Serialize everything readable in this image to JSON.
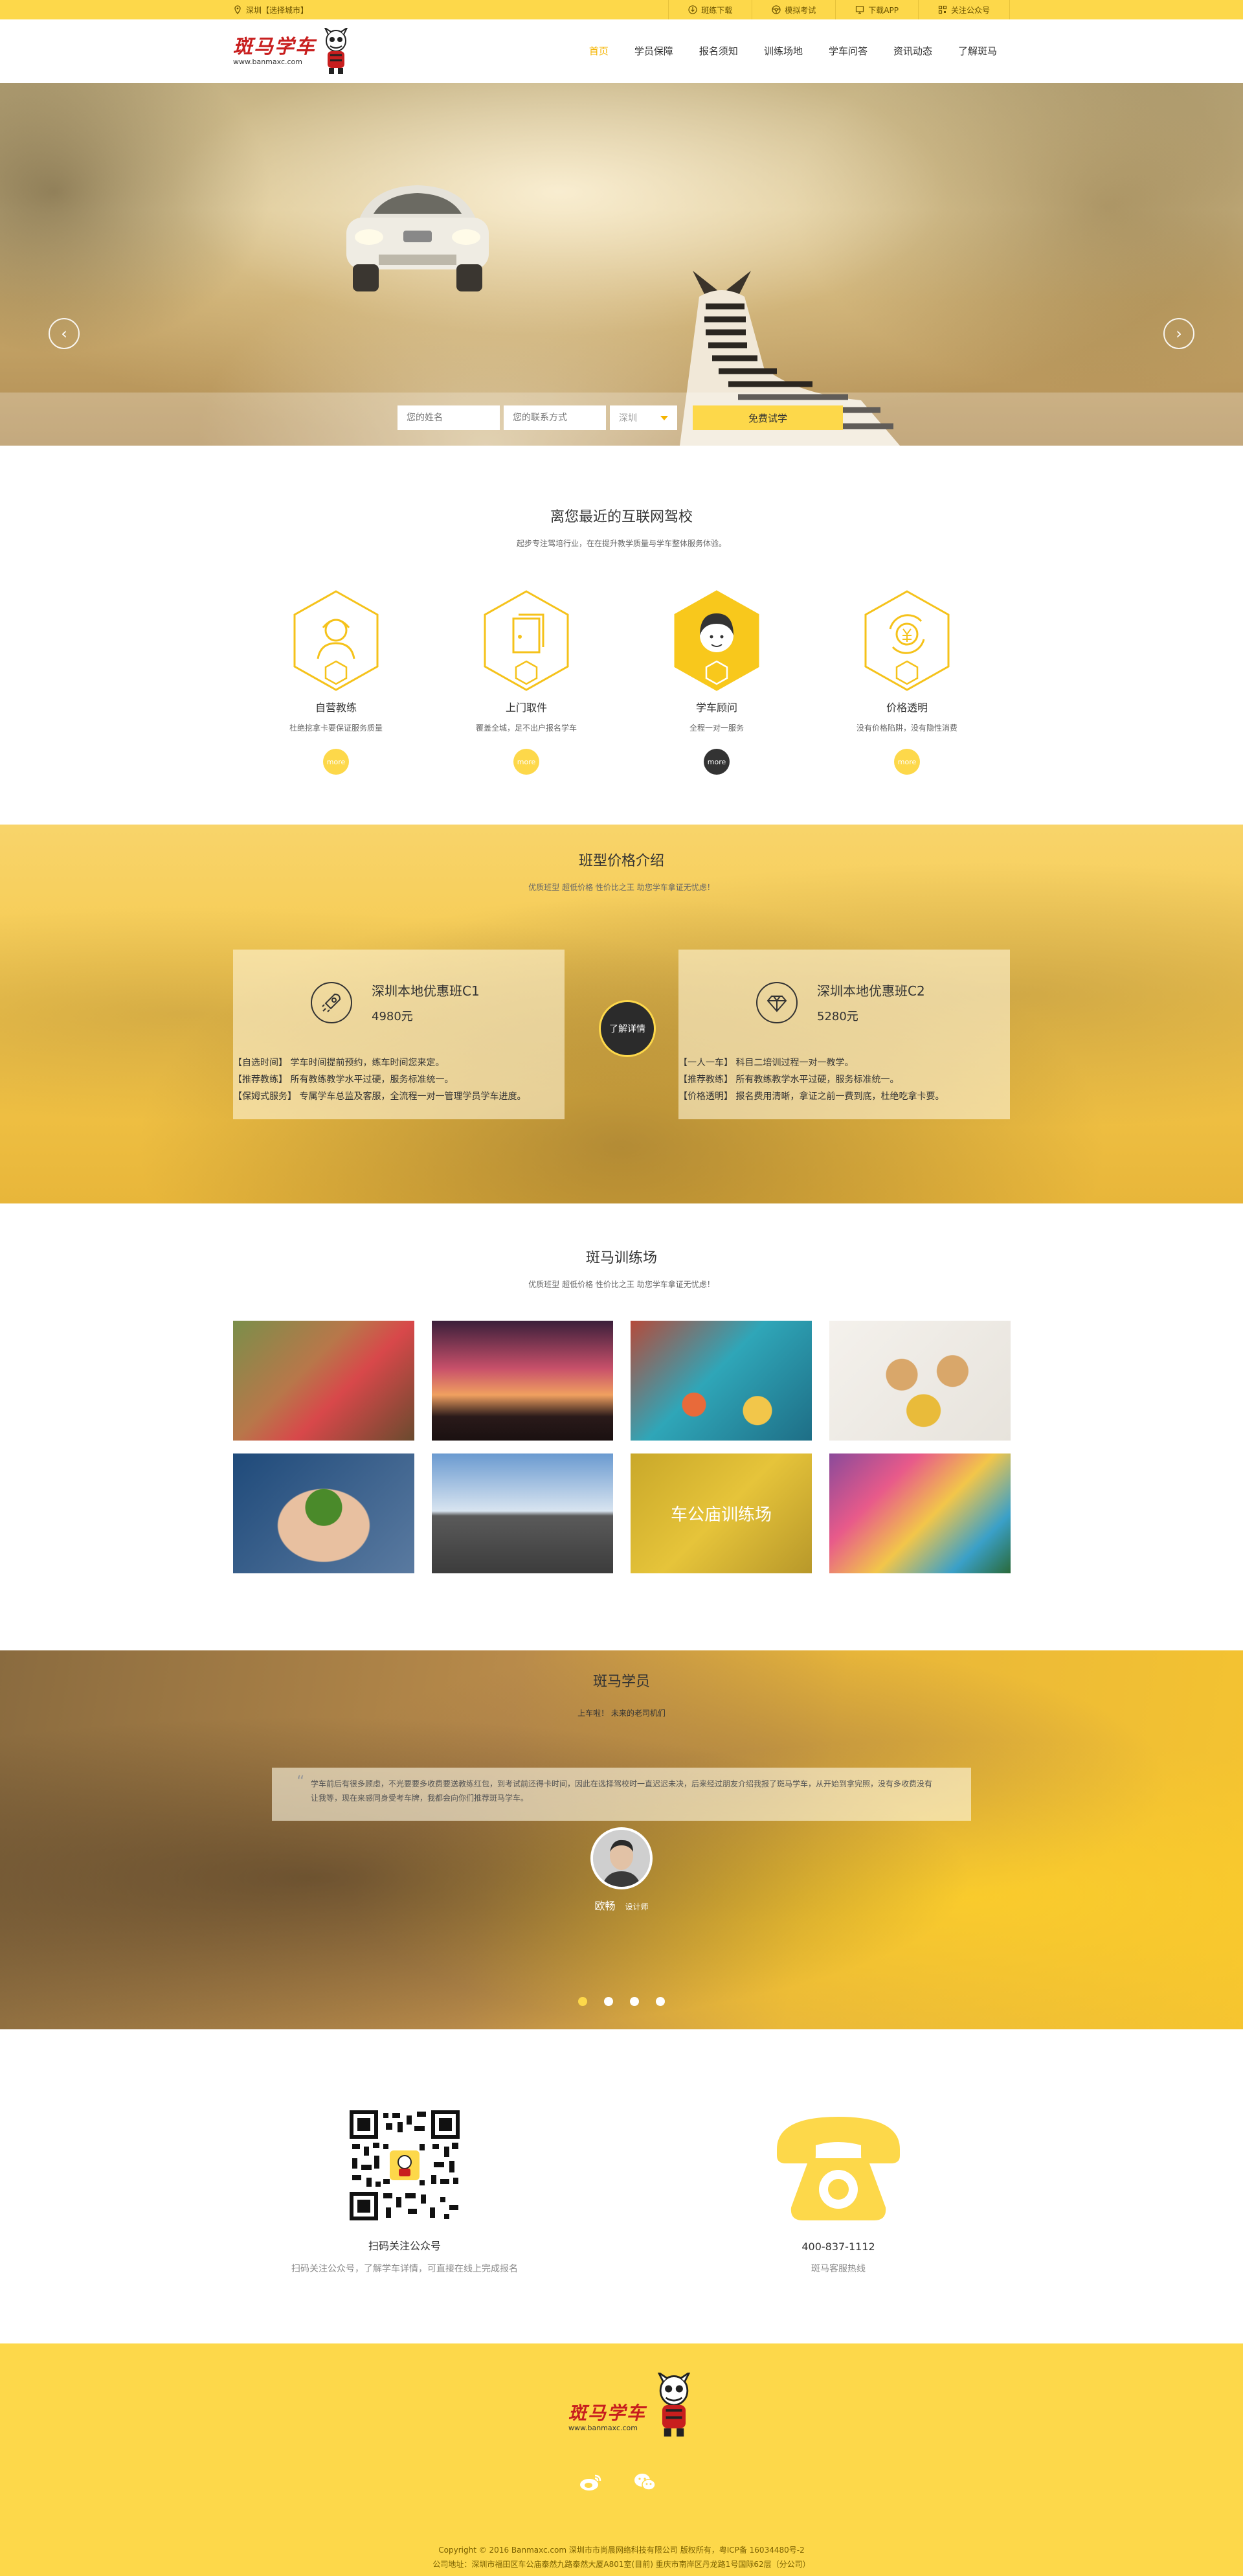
{
  "topbar": {
    "city": "深圳【选择城市】",
    "links": [
      "斑练下载",
      "模拟考试",
      "下载APP",
      "关注公众号"
    ]
  },
  "header": {
    "logo_cn": "斑马学车",
    "logo_url": "www.banmaxc.com",
    "nav": [
      "首页",
      "学员保障",
      "报名须知",
      "训练场地",
      "学车问答",
      "资讯动态",
      "了解斑马"
    ]
  },
  "hero": {
    "name_placeholder": "您的姓名",
    "contact_placeholder": "您的联系方式",
    "city_value": "深圳",
    "trial_button": "免费试学",
    "prev": "‹",
    "next": "›"
  },
  "schools": {
    "title": "离您最近的互联网驾校",
    "subtitle": "起步专注驾培行业，在在提升教学质量与学车整体服务体验。",
    "features": [
      {
        "title": "自营教练",
        "desc": "杜绝挖拿卡要保证服务质量",
        "more": "more"
      },
      {
        "title": "上门取件",
        "desc": "覆盖全城，足不出户报名学车",
        "more": "more"
      },
      {
        "title": "学车顾问",
        "desc": "全程一对一服务",
        "more": "more"
      },
      {
        "title": "价格透明",
        "desc": "没有价格陷阱，没有隐性消费",
        "more": "more"
      }
    ]
  },
  "pricing": {
    "title": "班型价格介绍",
    "subtitle": "优质班型 超低价格 性价比之王 助您学车拿证无忧虑！",
    "details_button": "了解详情",
    "cards": [
      {
        "name": "深圳本地优惠班C1",
        "price": "4980元",
        "lines": [
          "【自选时间】 学车时间提前预约，练车时间您来定。",
          "【推荐教练】 所有教练教学水平过硬，服务标准统一。",
          "【保姆式服务】 专属学车总监及客服，全流程一对一管理学员学车进度。"
        ]
      },
      {
        "name": "深圳本地优惠班C2",
        "price": "5280元",
        "lines": [
          "【一人一车】 科目二培训过程一对一教学。",
          "【推荐教练】 所有教练教学水平过硬，服务标准统一。",
          "【价格透明】 报名费用清晰，拿证之前一费到底，杜绝吃拿卡要。"
        ]
      }
    ]
  },
  "training": {
    "title": "斑马训练场",
    "subtitle": "优质班型 超低价格 性价比之王 助您学车拿证无忧虑！",
    "tiles": [
      {
        "label": ""
      },
      {
        "label": ""
      },
      {
        "label": ""
      },
      {
        "label": ""
      },
      {
        "label": ""
      },
      {
        "label": ""
      },
      {
        "label": "车公庙训练场"
      },
      {
        "label": ""
      }
    ]
  },
  "students": {
    "title": "斑马学员",
    "subtitle": "上车啦！ 未来的老司机们",
    "quote": "学车前后有很多顾虑，不光要要多收费要送教练红包，到考试前还得卡时间，因此在选择驾校时一直迟迟未决，后来经过朋友介绍我报了斑马学车，从开始到拿完照，没有多收费没有让我等，现在来感同身受考车牌，我都会向你们推荐斑马学车。",
    "student_name": "欧畅",
    "student_role": "设计师",
    "slides": 4
  },
  "contact": {
    "qr_title": "扫码关注公众号",
    "qr_desc": "扫码关注公众号，了解学车详情，可直接在线上完成报名",
    "phone_number": "400-837-1112",
    "phone_desc": "斑马客服热线"
  },
  "footer": {
    "logo_cn": "斑马学车",
    "logo_url": "www.banmaxc.com",
    "copyright": "Copyright © 2016 Banmaxc.com   深圳市市尚晨网络科技有限公司   版权所有，粤ICP备 16034480号-2",
    "address": "公司地址：深圳市福田区车公庙泰然九路泰然大厦A801室(目前)    重庆市南岸区丹龙路1号国际62层（分公司）"
  },
  "colors": {
    "brand_yellow": "#fdd84a",
    "accent": "#f5b400",
    "dark": "#333333"
  }
}
